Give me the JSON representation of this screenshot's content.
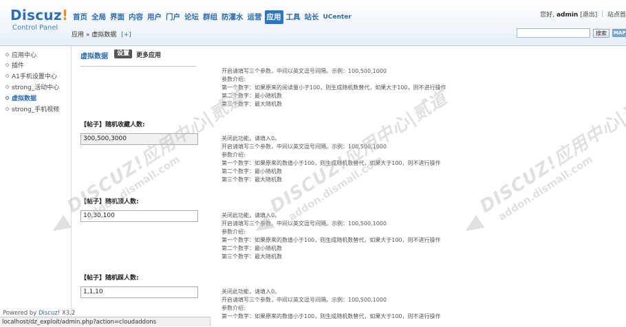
{
  "header": {
    "logo": {
      "brand": "Discuz",
      "bang": "!",
      "sub": "Control Panel"
    },
    "nav": [
      "首页",
      "全局",
      "界面",
      "内容",
      "用户",
      "门户",
      "论坛",
      "群组",
      "防灌水",
      "运营",
      "应用",
      "工具",
      "站长",
      "UCenter"
    ],
    "nav_active": "应用",
    "user": {
      "greeting": "您好,",
      "name": "admin",
      "logout": "[退出]",
      "site_home": "站点首"
    },
    "breadcrumb": "应用 » 虚拟数据",
    "breadcrumb_add": "[+]",
    "search_button": "搜索",
    "map_button": "MAP"
  },
  "sidebar": {
    "items": [
      "应用中心",
      "插件",
      "A1手机设置中心",
      "strong_活动中心",
      "虚拟数据",
      "strong_手机视频"
    ],
    "active": "虚拟数据",
    "powered_prefix": "Powered by",
    "powered_brand": "Discuz!",
    "powered_version": "X3.2"
  },
  "main": {
    "title": "虚拟数据",
    "tab_settings": "设置",
    "tab_more": "更多应用",
    "desc_top": [
      "开启请填写三个参数，中间以英文逗号间隔。示例：100,500,1000",
      "参数介绍:",
      "第一个数字：如果原来的阅读量小于100，则生成随机数替代，如果大于100，则不进行操作",
      "第二个数字：最小随机数",
      "第三个数字：最大随机数"
    ],
    "settings": [
      {
        "label": "【帖子】随机收藏人数:",
        "value": "300,500,3000",
        "desc": [
          "关闭此功能，请填入0。",
          "开启请填写三个参数，中间以英文逗号间隔。示例：100,500,1000",
          "参数介绍:",
          "第一个数字：如果原来的数值小于100，则生成随机数替代，如果大于100，则不进行操作",
          "第二个数字：最小随机数",
          "第三个数字：最大随机数"
        ]
      },
      {
        "label": "【帖子】随机顶人数:",
        "value": "10,30,100",
        "desc": [
          "关闭此功能，请填入0。",
          "开启请填写三个参数，中间以英文逗号间隔。示例：100,500,1000",
          "参数介绍:",
          "第一个数字：如果原来的数值小于100，则生成随机数替代，如果大于100，则不进行操作",
          "第二个数字：最小随机数",
          "第三个数字：最大随机数"
        ]
      },
      {
        "label": "【帖子】随机踩人数:",
        "value": "1,1,10",
        "desc": [
          "关闭此功能，请填入0。",
          "开启请填写三个参数，中间以英文逗号间隔。示例：100,500,1000",
          "参数介绍:",
          "第一个数字：如果原来的数值小于100，则生成随机数替代，如果大于100，则不进行操作"
        ]
      }
    ]
  },
  "watermark": {
    "line1": "DISCUZ!应用中心|贰道",
    "line2": "addon.dismall.com"
  },
  "statusbar": "localhost/dz_exploit/admin.php?action=cloudaddons"
}
